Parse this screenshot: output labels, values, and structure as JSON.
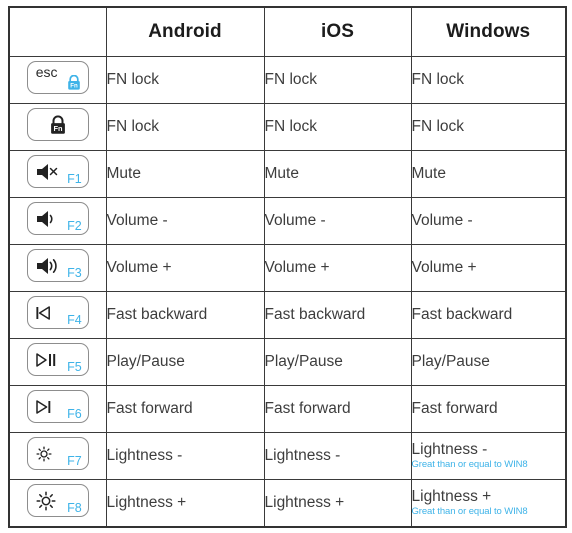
{
  "table": {
    "headers": [
      "",
      "Android",
      "iOS",
      "Windows"
    ],
    "colors": {
      "accent_blue": "#3eb3e8",
      "text": "#3d3d3d",
      "header_text": "#1c1c1c",
      "border": "#3a3a3a",
      "key_border": "#8d8d8d",
      "lock_dark": "#222222"
    },
    "rows": [
      {
        "key": {
          "label": "esc",
          "fkey": "",
          "icon": "fn-lock-blue-icon",
          "icon_text": "Fn"
        },
        "android": {
          "main": "FN lock",
          "note": ""
        },
        "ios": {
          "main": "FN lock",
          "note": ""
        },
        "windows": {
          "main": "FN lock",
          "note": ""
        }
      },
      {
        "key": {
          "label": "",
          "fkey": "",
          "icon": "fn-lock-dark-icon",
          "icon_text": "Fn"
        },
        "android": {
          "main": "FN lock",
          "note": ""
        },
        "ios": {
          "main": "FN lock",
          "note": ""
        },
        "windows": {
          "main": "FN lock",
          "note": ""
        }
      },
      {
        "key": {
          "label": "",
          "fkey": "F1",
          "icon": "speaker-mute-icon",
          "icon_text": ""
        },
        "android": {
          "main": "Mute",
          "note": ""
        },
        "ios": {
          "main": "Mute",
          "note": ""
        },
        "windows": {
          "main": "Mute",
          "note": ""
        }
      },
      {
        "key": {
          "label": "",
          "fkey": "F2",
          "icon": "volume-down-icon",
          "icon_text": ""
        },
        "android": {
          "main": "Volume -",
          "note": ""
        },
        "ios": {
          "main": "Volume -",
          "note": ""
        },
        "windows": {
          "main": "Volume -",
          "note": ""
        }
      },
      {
        "key": {
          "label": "",
          "fkey": "F3",
          "icon": "volume-up-icon",
          "icon_text": ""
        },
        "android": {
          "main": "Volume +",
          "note": ""
        },
        "ios": {
          "main": "Volume +",
          "note": ""
        },
        "windows": {
          "main": "Volume +",
          "note": ""
        }
      },
      {
        "key": {
          "label": "",
          "fkey": "F4",
          "icon": "previous-track-icon",
          "icon_text": ""
        },
        "android": {
          "main": "Fast backward",
          "note": ""
        },
        "ios": {
          "main": "Fast backward",
          "note": ""
        },
        "windows": {
          "main": "Fast backward",
          "note": ""
        }
      },
      {
        "key": {
          "label": "",
          "fkey": "F5",
          "icon": "play-pause-icon",
          "icon_text": ""
        },
        "android": {
          "main": "Play/Pause",
          "note": ""
        },
        "ios": {
          "main": "Play/Pause",
          "note": ""
        },
        "windows": {
          "main": "Play/Pause",
          "note": ""
        }
      },
      {
        "key": {
          "label": "",
          "fkey": "F6",
          "icon": "next-track-icon",
          "icon_text": ""
        },
        "android": {
          "main": "Fast forward",
          "note": ""
        },
        "ios": {
          "main": "Fast forward",
          "note": ""
        },
        "windows": {
          "main": "Fast forward",
          "note": ""
        }
      },
      {
        "key": {
          "label": "",
          "fkey": "F7",
          "icon": "brightness-down-icon",
          "icon_text": ""
        },
        "android": {
          "main": "Lightness -",
          "note": ""
        },
        "ios": {
          "main": "Lightness -",
          "note": ""
        },
        "windows": {
          "main": "Lightness -",
          "note": "Great than or equal to WIN8"
        }
      },
      {
        "key": {
          "label": "",
          "fkey": "F8",
          "icon": "brightness-up-icon",
          "icon_text": ""
        },
        "android": {
          "main": "Lightness +",
          "note": ""
        },
        "ios": {
          "main": "Lightness +",
          "note": ""
        },
        "windows": {
          "main": "Lightness +",
          "note": "Great than or equal to WIN8"
        }
      }
    ]
  }
}
